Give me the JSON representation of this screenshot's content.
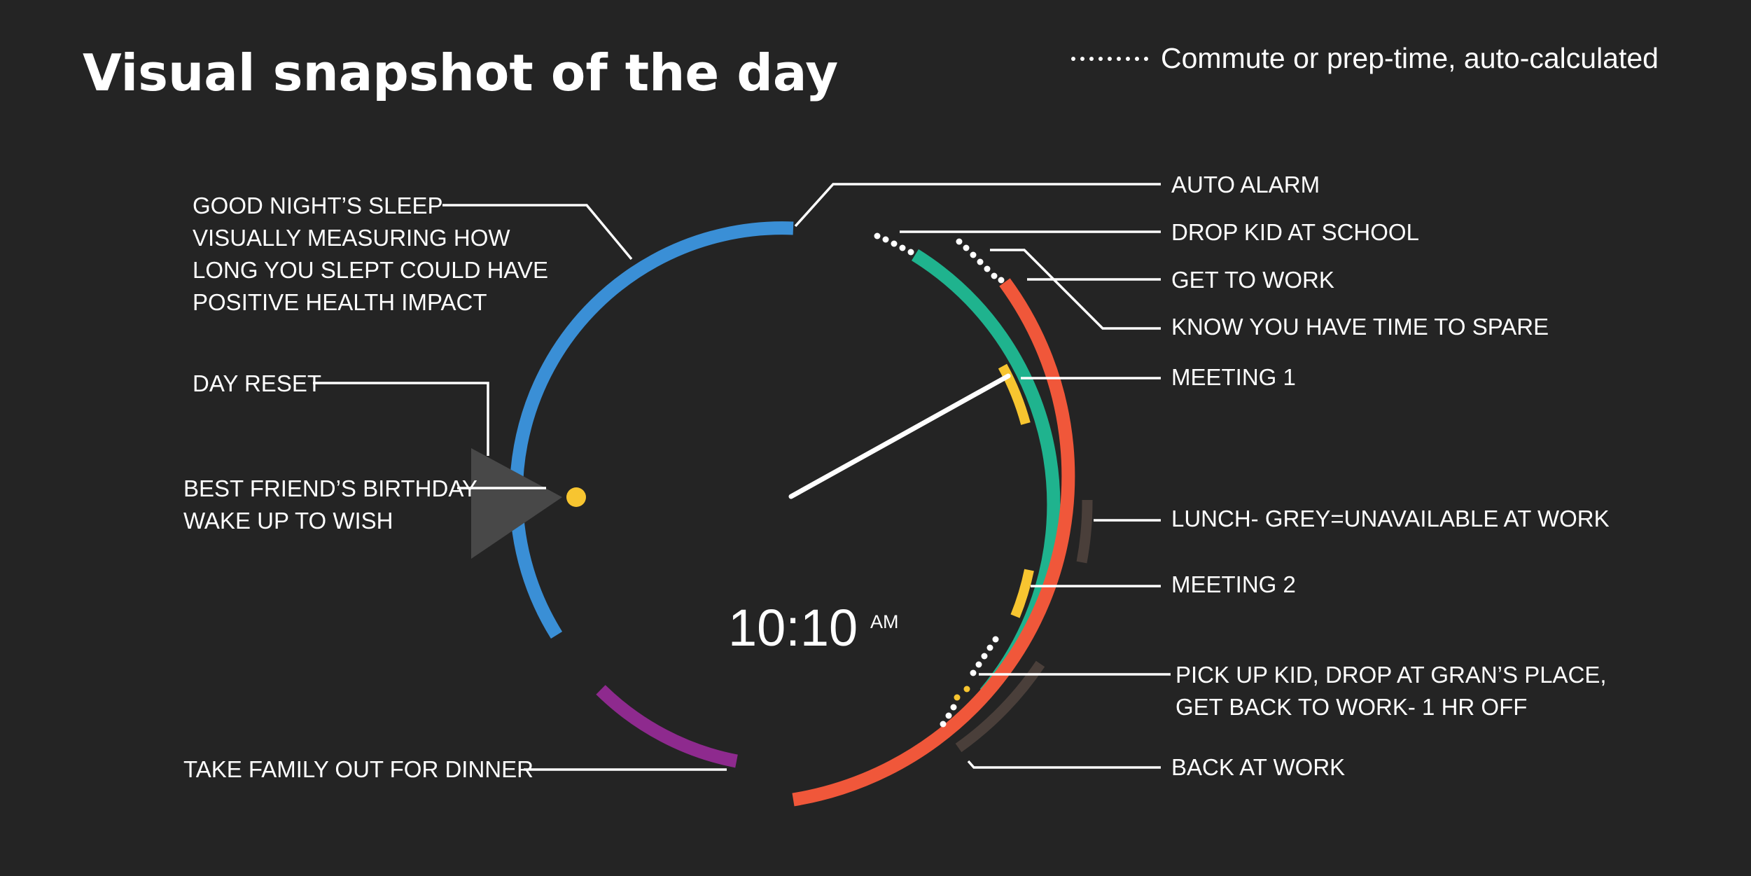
{
  "title": "Visual snapshot of the day",
  "legend": {
    "label": "Commute or prep-time, auto-calculated"
  },
  "clock": {
    "time": "10:10",
    "ampm": "AM"
  },
  "labels": {
    "sleep": [
      "GOOD NIGHT’S SLEEP",
      "VISUALLY MEASURING HOW",
      "LONG YOU SLEPT COULD HAVE",
      "POSITIVE HEALTH IMPACT"
    ],
    "day_reset": "DAY RESET",
    "birthday": [
      "BEST FRIEND’S BIRTHDAY",
      "WAKE UP TO WISH"
    ],
    "dinner": "TAKE FAMILY OUT FOR DINNER",
    "auto_alarm": "AUTO ALARM",
    "drop_kid": "DROP KID AT SCHOOL",
    "get_to_work": "GET TO WORK",
    "time_to_spare": "KNOW YOU HAVE TIME TO SPARE",
    "meeting1": "MEETING 1",
    "lunch": "LUNCH- GREY=UNAVAILABLE AT WORK",
    "meeting2": "MEETING 2",
    "pickup": [
      "PICK UP KID, DROP AT GRAN’S PLACE,",
      "GET BACK TO WORK- 1 HR OFF"
    ],
    "back_at_work": "BACK AT WORK"
  },
  "colors": {
    "background": "#242424",
    "sleep": "#3a8fd6",
    "kid": "#1fb38e",
    "work": "#f0573a",
    "meeting": "#f7c530",
    "dinner": "#8e2a8e",
    "unavailable": "#4a3f3a",
    "day_reset_marker": "#484848",
    "birthday_dot": "#f7c530"
  }
}
